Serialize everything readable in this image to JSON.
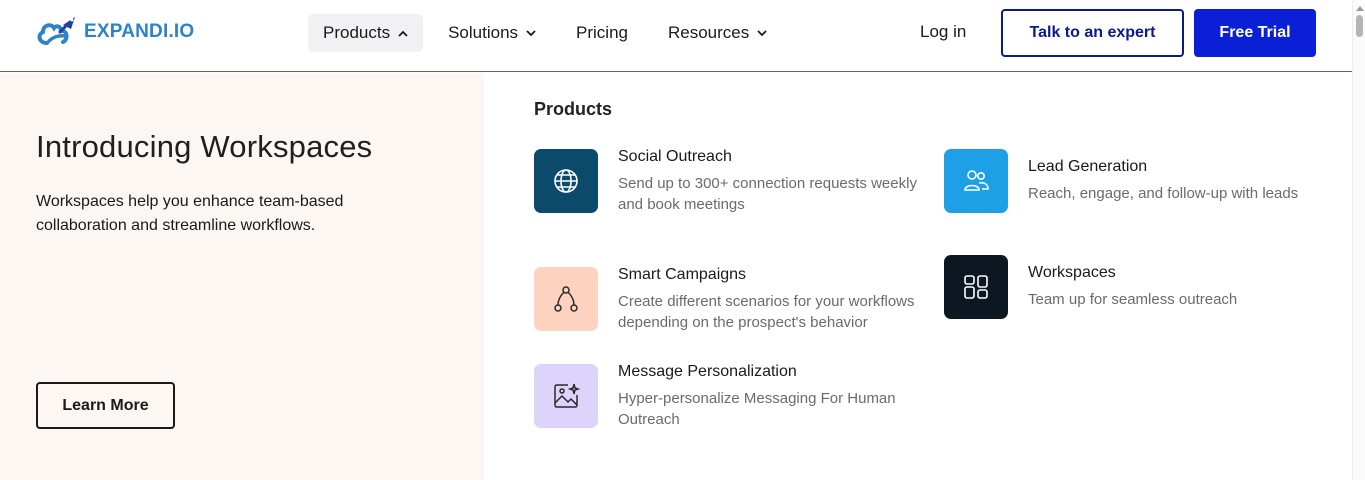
{
  "brand": {
    "name": "EXPANDI.IO",
    "color": "#2d83c9"
  },
  "nav": {
    "items": [
      {
        "label": "Products",
        "icon": "chevron-up-icon",
        "active": true
      },
      {
        "label": "Solutions",
        "icon": "chevron-down-icon"
      },
      {
        "label": "Pricing"
      },
      {
        "label": "Resources",
        "icon": "chevron-down-icon"
      }
    ],
    "login_label": "Log in",
    "expert_label": "Talk to an expert",
    "trial_label": "Free Trial"
  },
  "promo": {
    "title": "Introducing Workspaces",
    "description": "Workspaces help you enhance team-based collaboration and streamline workflows.",
    "cta_label": "Learn More"
  },
  "menu": {
    "heading": "Products",
    "products": [
      {
        "name": "Social Outreach",
        "description": "Send up to 300+ connection requests weekly and book meetings",
        "icon": "globe-icon",
        "tile_color": "#0b4a6b"
      },
      {
        "name": "Lead Generation",
        "description": "Reach, engage, and follow-up with leads",
        "icon": "users-icon",
        "tile_color": "#1ea0e6"
      },
      {
        "name": "Smart Campaigns",
        "description": "Create different scenarios for your workflows depending on the prospect's behavior",
        "icon": "branch-icon",
        "tile_color": "#fdd3c0"
      },
      {
        "name": "Workspaces",
        "description": "Team up for seamless outreach",
        "icon": "grid-icon",
        "tile_color": "#0c1722"
      },
      {
        "name": "Message Personalization",
        "description": "Hyper-personalize Messaging For Human Outreach",
        "icon": "image-sparkle-icon",
        "tile_color": "#dcd4fb"
      }
    ]
  },
  "colors": {
    "primary": "#0b1fd6",
    "outline": "#0a1a8c",
    "promo_bg": "#fdf7f4"
  }
}
